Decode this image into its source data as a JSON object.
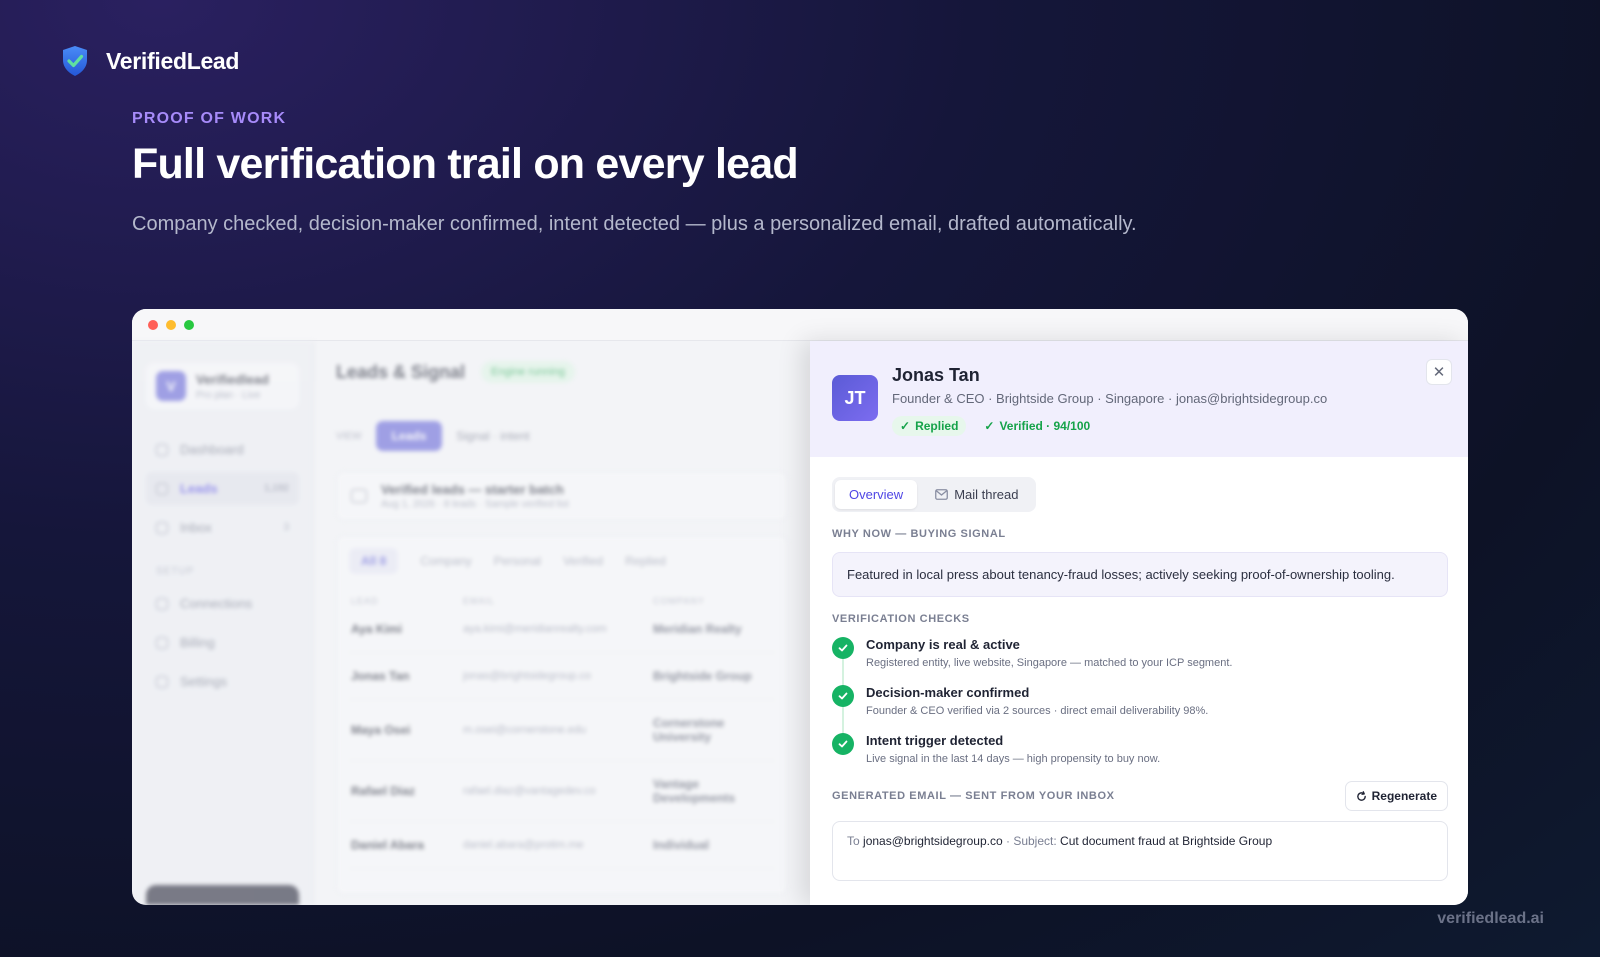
{
  "brand": {
    "name": "VerifiedLead",
    "accent": "#a78bfa"
  },
  "hero": {
    "eyebrow": "PROOF OF WORK",
    "title": "Full verification trail on every lead",
    "subtitle": "Company checked, decision-maker confirmed, intent detected — plus a personalized email, drafted automatically."
  },
  "footer": {
    "url": "verifiedlead.ai"
  },
  "app": {
    "workspace": {
      "name": "Verifiedlead",
      "sub": "Pro plan · Live",
      "initial": "V"
    },
    "nav": [
      {
        "label": "Dashboard",
        "badge": ""
      },
      {
        "label": "Leads",
        "badge": "1,192"
      },
      {
        "label": "Inbox",
        "badge": "3"
      }
    ],
    "setup_label": "SETUP",
    "setup_nav": [
      {
        "label": "Connections"
      },
      {
        "label": "Billing"
      },
      {
        "label": "Settings"
      }
    ],
    "title": "Leads & Signal",
    "engine_status": "Engine running",
    "view_label": "VIEW",
    "view_tabs": [
      "Leads",
      "Signal · intent"
    ],
    "batch": {
      "title": "Verified leads — starter batch",
      "sub": "Aug 1, 2026 · 8 leads · Sample verified list"
    },
    "filters": [
      "All  8",
      "Company",
      "Personal",
      "Verified",
      "Replied"
    ],
    "columns": [
      "LEAD",
      "EMAIL",
      "COMPANY"
    ],
    "rows": [
      {
        "lead": "Aya Kimi",
        "email": "aya.kimi@meridianrealty.com",
        "company": "Meridian Realty"
      },
      {
        "lead": "Jonas Tan",
        "email": "jonas@brightsidegroup.co",
        "company": "Brightside Group"
      },
      {
        "lead": "Maya Osei",
        "email": "m.osei@cornerstone.edu",
        "company": "Cornerstone University"
      },
      {
        "lead": "Rafael Diaz",
        "email": "rafael.diaz@vantagedev.co",
        "company": "Vantage Developments"
      },
      {
        "lead": "Daniel Abara",
        "email": "daniel.abara@protim.me",
        "company": "Individual"
      }
    ]
  },
  "drawer": {
    "initials": "JT",
    "name": "Jonas Tan",
    "meta": "Founder & CEO · Brightside Group · Singapore · jonas@brightsidegroup.co",
    "chip_replied": "Replied",
    "chip_verified": "Verified · 94/100",
    "close_glyph": "✕",
    "tabs": {
      "overview": "Overview",
      "mail": "Mail thread"
    },
    "why_now_label": "WHY NOW — BUYING SIGNAL",
    "signal": "Featured in local press about tenancy-fraud losses; actively seeking proof-of-ownership tooling.",
    "checks_label": "VERIFICATION CHECKS",
    "checks": [
      {
        "title": "Company is real & active",
        "desc": "Registered entity, live website, Singapore — matched to your ICP segment."
      },
      {
        "title": "Decision-maker confirmed",
        "desc": "Founder & CEO verified via 2 sources · direct email deliverability 98%."
      },
      {
        "title": "Intent trigger detected",
        "desc": "Live signal in the last 14 days — high propensity to buy now."
      }
    ],
    "email_label": "GENERATED EMAIL — SENT FROM YOUR INBOX",
    "regenerate": "Regenerate",
    "email": {
      "to_label": "To",
      "to": "jonas@brightsidegroup.co",
      "subject_label": "· Subject:",
      "subject": "Cut document fraud at Brightside Group"
    }
  }
}
